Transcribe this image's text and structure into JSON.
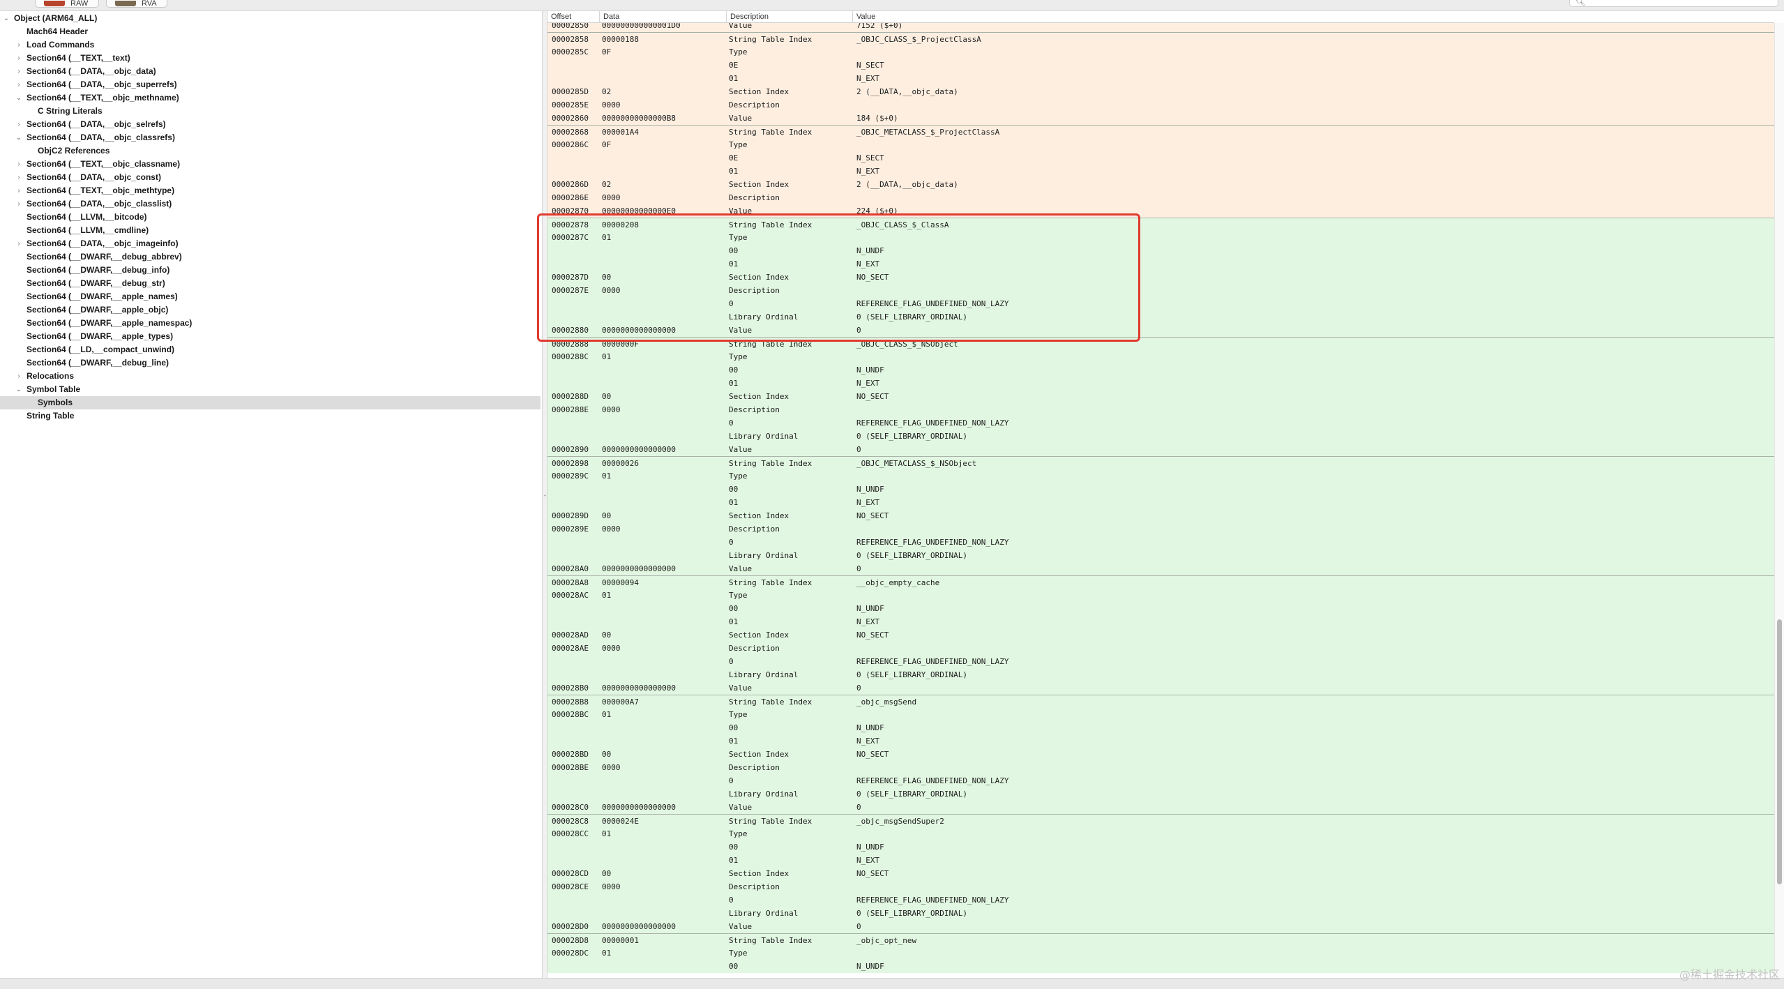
{
  "toolbar": {
    "raw_label": "RAW",
    "rva_label": "RVA",
    "raw_color": "#b8442c",
    "rva_color": "#7b6a52"
  },
  "tree": [
    {
      "label": "Object  (ARM64_ALL)",
      "level": 0,
      "disclosure": "open"
    },
    {
      "label": "Mach64 Header",
      "level": 1,
      "disclosure": "none"
    },
    {
      "label": "Load Commands",
      "level": 1,
      "disclosure": "closed"
    },
    {
      "label": "Section64 (__TEXT,__text)",
      "level": 1,
      "disclosure": "closed"
    },
    {
      "label": "Section64 (__DATA,__objc_data)",
      "level": 1,
      "disclosure": "closed"
    },
    {
      "label": "Section64 (__DATA,__objc_superrefs)",
      "level": 1,
      "disclosure": "closed"
    },
    {
      "label": "Section64 (__TEXT,__objc_methname)",
      "level": 1,
      "disclosure": "open"
    },
    {
      "label": "C String Literals",
      "level": 2,
      "disclosure": "none"
    },
    {
      "label": "Section64 (__DATA,__objc_selrefs)",
      "level": 1,
      "disclosure": "closed"
    },
    {
      "label": "Section64 (__DATA,__objc_classrefs)",
      "level": 1,
      "disclosure": "open"
    },
    {
      "label": "ObjC2 References",
      "level": 2,
      "disclosure": "none"
    },
    {
      "label": "Section64 (__TEXT,__objc_classname)",
      "level": 1,
      "disclosure": "closed"
    },
    {
      "label": "Section64 (__DATA,__objc_const)",
      "level": 1,
      "disclosure": "closed"
    },
    {
      "label": "Section64 (__TEXT,__objc_methtype)",
      "level": 1,
      "disclosure": "closed"
    },
    {
      "label": "Section64 (__DATA,__objc_classlist)",
      "level": 1,
      "disclosure": "closed"
    },
    {
      "label": "Section64 (__LLVM,__bitcode)",
      "level": 1,
      "disclosure": "none"
    },
    {
      "label": "Section64 (__LLVM,__cmdline)",
      "level": 1,
      "disclosure": "none"
    },
    {
      "label": "Section64 (__DATA,__objc_imageinfo)",
      "level": 1,
      "disclosure": "closed"
    },
    {
      "label": "Section64 (__DWARF,__debug_abbrev)",
      "level": 1,
      "disclosure": "none"
    },
    {
      "label": "Section64 (__DWARF,__debug_info)",
      "level": 1,
      "disclosure": "none"
    },
    {
      "label": "Section64 (__DWARF,__debug_str)",
      "level": 1,
      "disclosure": "none"
    },
    {
      "label": "Section64 (__DWARF,__apple_names)",
      "level": 1,
      "disclosure": "none"
    },
    {
      "label": "Section64 (__DWARF,__apple_objc)",
      "level": 1,
      "disclosure": "none"
    },
    {
      "label": "Section64 (__DWARF,__apple_namespac)",
      "level": 1,
      "disclosure": "none"
    },
    {
      "label": "Section64 (__DWARF,__apple_types)",
      "level": 1,
      "disclosure": "none"
    },
    {
      "label": "Section64 (__LD,__compact_unwind)",
      "level": 1,
      "disclosure": "none"
    },
    {
      "label": "Section64 (__DWARF,__debug_line)",
      "level": 1,
      "disclosure": "none"
    },
    {
      "label": "Relocations",
      "level": 1,
      "disclosure": "closed"
    },
    {
      "label": "Symbol Table",
      "level": 1,
      "disclosure": "open"
    },
    {
      "label": "Symbols",
      "level": 2,
      "disclosure": "none",
      "selected": true
    },
    {
      "label": "String Table",
      "level": 1,
      "disclosure": "none"
    }
  ],
  "table": {
    "columns": [
      "Offset",
      "Data",
      "Description",
      "Value"
    ],
    "colors": {
      "peach": "#fdeee0",
      "green": "#e1f7e1",
      "selected_row": "#dcdcdc",
      "highlight_border": "#e03a2f"
    },
    "rows": [
      {
        "offset": "00002850",
        "data": "000000000000001D0",
        "desc": "Value",
        "value": "7152 ($+0)",
        "color": "peach",
        "group_start": false
      },
      {
        "offset": "00002858",
        "data": "00000188",
        "desc": "String Table Index",
        "value": "_OBJC_CLASS_$_ProjectClassA",
        "color": "peach",
        "group_start": true
      },
      {
        "offset": "0000285C",
        "data": "0F",
        "desc": "Type",
        "value": "",
        "color": "peach"
      },
      {
        "offset": "",
        "data": "",
        "desc": "0E",
        "value": "N_SECT",
        "color": "peach"
      },
      {
        "offset": "",
        "data": "",
        "desc": "01",
        "value": "N_EXT",
        "color": "peach"
      },
      {
        "offset": "0000285D",
        "data": "02",
        "desc": "Section Index",
        "value": "2 (__DATA,__objc_data)",
        "color": "peach"
      },
      {
        "offset": "0000285E",
        "data": "0000",
        "desc": "Description",
        "value": "",
        "color": "peach"
      },
      {
        "offset": "00002860",
        "data": "00000000000000B8",
        "desc": "Value",
        "value": "184 ($+0)",
        "color": "peach"
      },
      {
        "offset": "00002868",
        "data": "000001A4",
        "desc": "String Table Index",
        "value": "_OBJC_METACLASS_$_ProjectClassA",
        "color": "peach",
        "group_start": true
      },
      {
        "offset": "0000286C",
        "data": "0F",
        "desc": "Type",
        "value": "",
        "color": "peach"
      },
      {
        "offset": "",
        "data": "",
        "desc": "0E",
        "value": "N_SECT",
        "color": "peach"
      },
      {
        "offset": "",
        "data": "",
        "desc": "01",
        "value": "N_EXT",
        "color": "peach"
      },
      {
        "offset": "0000286D",
        "data": "02",
        "desc": "Section Index",
        "value": "2 (__DATA,__objc_data)",
        "color": "peach"
      },
      {
        "offset": "0000286E",
        "data": "0000",
        "desc": "Description",
        "value": "",
        "color": "peach"
      },
      {
        "offset": "00002870",
        "data": "00000000000000E0",
        "desc": "Value",
        "value": "224 ($+0)",
        "color": "peach"
      },
      {
        "offset": "00002878",
        "data": "00000208",
        "desc": "String Table Index",
        "value": "_OBJC_CLASS_$_ClassA",
        "color": "green",
        "group_start": true
      },
      {
        "offset": "0000287C",
        "data": "01",
        "desc": "Type",
        "value": "",
        "color": "green"
      },
      {
        "offset": "",
        "data": "",
        "desc": "00",
        "value": "N_UNDF",
        "color": "green"
      },
      {
        "offset": "",
        "data": "",
        "desc": "01",
        "value": "N_EXT",
        "color": "green"
      },
      {
        "offset": "0000287D",
        "data": "00",
        "desc": "Section Index",
        "value": "NO_SECT",
        "color": "green"
      },
      {
        "offset": "0000287E",
        "data": "0000",
        "desc": "Description",
        "value": "",
        "color": "green"
      },
      {
        "offset": "",
        "data": "",
        "desc": "0",
        "value": "REFERENCE_FLAG_UNDEFINED_NON_LAZY",
        "color": "green"
      },
      {
        "offset": "",
        "data": "",
        "desc": "Library Ordinal",
        "value": "0 (SELF_LIBRARY_ORDINAL)",
        "color": "green"
      },
      {
        "offset": "00002880",
        "data": "0000000000000000",
        "desc": "Value",
        "value": "0",
        "color": "green"
      },
      {
        "offset": "00002888",
        "data": "0000000F",
        "desc": "String Table Index",
        "value": "_OBJC_CLASS_$_NSObject",
        "color": "green",
        "group_start": true
      },
      {
        "offset": "0000288C",
        "data": "01",
        "desc": "Type",
        "value": "",
        "color": "green"
      },
      {
        "offset": "",
        "data": "",
        "desc": "00",
        "value": "N_UNDF",
        "color": "green"
      },
      {
        "offset": "",
        "data": "",
        "desc": "01",
        "value": "N_EXT",
        "color": "green"
      },
      {
        "offset": "0000288D",
        "data": "00",
        "desc": "Section Index",
        "value": "NO_SECT",
        "color": "green"
      },
      {
        "offset": "0000288E",
        "data": "0000",
        "desc": "Description",
        "value": "",
        "color": "green"
      },
      {
        "offset": "",
        "data": "",
        "desc": "0",
        "value": "REFERENCE_FLAG_UNDEFINED_NON_LAZY",
        "color": "green"
      },
      {
        "offset": "",
        "data": "",
        "desc": "Library Ordinal",
        "value": "0 (SELF_LIBRARY_ORDINAL)",
        "color": "green"
      },
      {
        "offset": "00002890",
        "data": "0000000000000000",
        "desc": "Value",
        "value": "0",
        "color": "green"
      },
      {
        "offset": "00002898",
        "data": "00000026",
        "desc": "String Table Index",
        "value": "_OBJC_METACLASS_$_NSObject",
        "color": "green",
        "group_start": true
      },
      {
        "offset": "0000289C",
        "data": "01",
        "desc": "Type",
        "value": "",
        "color": "green"
      },
      {
        "offset": "",
        "data": "",
        "desc": "00",
        "value": "N_UNDF",
        "color": "green"
      },
      {
        "offset": "",
        "data": "",
        "desc": "01",
        "value": "N_EXT",
        "color": "green"
      },
      {
        "offset": "0000289D",
        "data": "00",
        "desc": "Section Index",
        "value": "NO_SECT",
        "color": "green"
      },
      {
        "offset": "0000289E",
        "data": "0000",
        "desc": "Description",
        "value": "",
        "color": "green"
      },
      {
        "offset": "",
        "data": "",
        "desc": "0",
        "value": "REFERENCE_FLAG_UNDEFINED_NON_LAZY",
        "color": "green"
      },
      {
        "offset": "",
        "data": "",
        "desc": "Library Ordinal",
        "value": "0 (SELF_LIBRARY_ORDINAL)",
        "color": "green"
      },
      {
        "offset": "000028A0",
        "data": "0000000000000000",
        "desc": "Value",
        "value": "0",
        "color": "green"
      },
      {
        "offset": "000028A8",
        "data": "00000094",
        "desc": "String Table Index",
        "value": "__objc_empty_cache",
        "color": "green",
        "group_start": true
      },
      {
        "offset": "000028AC",
        "data": "01",
        "desc": "Type",
        "value": "",
        "color": "green"
      },
      {
        "offset": "",
        "data": "",
        "desc": "00",
        "value": "N_UNDF",
        "color": "green"
      },
      {
        "offset": "",
        "data": "",
        "desc": "01",
        "value": "N_EXT",
        "color": "green"
      },
      {
        "offset": "000028AD",
        "data": "00",
        "desc": "Section Index",
        "value": "NO_SECT",
        "color": "green"
      },
      {
        "offset": "000028AE",
        "data": "0000",
        "desc": "Description",
        "value": "",
        "color": "green"
      },
      {
        "offset": "",
        "data": "",
        "desc": "0",
        "value": "REFERENCE_FLAG_UNDEFINED_NON_LAZY",
        "color": "green"
      },
      {
        "offset": "",
        "data": "",
        "desc": "Library Ordinal",
        "value": "0 (SELF_LIBRARY_ORDINAL)",
        "color": "green"
      },
      {
        "offset": "000028B0",
        "data": "0000000000000000",
        "desc": "Value",
        "value": "0",
        "color": "green"
      },
      {
        "offset": "000028B8",
        "data": "000000A7",
        "desc": "String Table Index",
        "value": "_objc_msgSend",
        "color": "green",
        "group_start": true
      },
      {
        "offset": "000028BC",
        "data": "01",
        "desc": "Type",
        "value": "",
        "color": "green"
      },
      {
        "offset": "",
        "data": "",
        "desc": "00",
        "value": "N_UNDF",
        "color": "green"
      },
      {
        "offset": "",
        "data": "",
        "desc": "01",
        "value": "N_EXT",
        "color": "green"
      },
      {
        "offset": "000028BD",
        "data": "00",
        "desc": "Section Index",
        "value": "NO_SECT",
        "color": "green"
      },
      {
        "offset": "000028BE",
        "data": "0000",
        "desc": "Description",
        "value": "",
        "color": "green"
      },
      {
        "offset": "",
        "data": "",
        "desc": "0",
        "value": "REFERENCE_FLAG_UNDEFINED_NON_LAZY",
        "color": "green"
      },
      {
        "offset": "",
        "data": "",
        "desc": "Library Ordinal",
        "value": "0 (SELF_LIBRARY_ORDINAL)",
        "color": "green"
      },
      {
        "offset": "000028C0",
        "data": "0000000000000000",
        "desc": "Value",
        "value": "0",
        "color": "green"
      },
      {
        "offset": "000028C8",
        "data": "0000024E",
        "desc": "String Table Index",
        "value": "_objc_msgSendSuper2",
        "color": "green",
        "group_start": true
      },
      {
        "offset": "000028CC",
        "data": "01",
        "desc": "Type",
        "value": "",
        "color": "green"
      },
      {
        "offset": "",
        "data": "",
        "desc": "00",
        "value": "N_UNDF",
        "color": "green"
      },
      {
        "offset": "",
        "data": "",
        "desc": "01",
        "value": "N_EXT",
        "color": "green"
      },
      {
        "offset": "000028CD",
        "data": "00",
        "desc": "Section Index",
        "value": "NO_SECT",
        "color": "green"
      },
      {
        "offset": "000028CE",
        "data": "0000",
        "desc": "Description",
        "value": "",
        "color": "green"
      },
      {
        "offset": "",
        "data": "",
        "desc": "0",
        "value": "REFERENCE_FLAG_UNDEFINED_NON_LAZY",
        "color": "green"
      },
      {
        "offset": "",
        "data": "",
        "desc": "Library Ordinal",
        "value": "0 (SELF_LIBRARY_ORDINAL)",
        "color": "green"
      },
      {
        "offset": "000028D0",
        "data": "0000000000000000",
        "desc": "Value",
        "value": "0",
        "color": "green"
      },
      {
        "offset": "000028D8",
        "data": "00000001",
        "desc": "String Table Index",
        "value": "_objc_opt_new",
        "color": "green",
        "group_start": true
      },
      {
        "offset": "000028DC",
        "data": "01",
        "desc": "Type",
        "value": "",
        "color": "green"
      },
      {
        "offset": "",
        "data": "",
        "desc": "00",
        "value": "N_UNDF",
        "color": "green"
      }
    ]
  },
  "watermark": "@稀土掘金技术社区"
}
